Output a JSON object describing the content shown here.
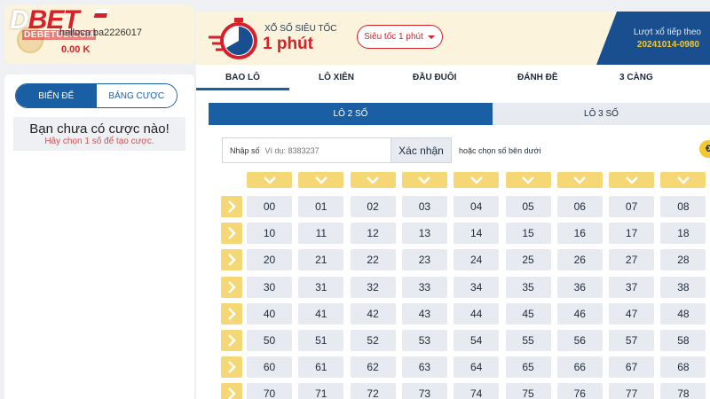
{
  "brand": {
    "logo_d": "D",
    "logo_bet": "BET",
    "logo_sub": "DEBETUS.COM"
  },
  "user": {
    "name": "helloca ba2226017",
    "balance": "0.00 K"
  },
  "left_tabs": [
    "BIẾN ĐỂ",
    "BẢNG CƯỢC"
  ],
  "empty_state": {
    "title": "Bạn chưa có cược nào!",
    "hint": "Hãy chọn 1 số để tạo cược."
  },
  "header": {
    "subtitle": "XỔ SỐ SIÊU TỐC",
    "title": "1 phút",
    "select": "Siêu tốc 1 phút",
    "next_label": "Lượt xổ tiếp theo",
    "next_value": "20241014-0980"
  },
  "bet_tabs": [
    "BAO LÔ",
    "LÔ XIÊN",
    "ĐẦU ĐUÔI",
    "ĐÁNH ĐỀ",
    "3 CÀNG"
  ],
  "sub_tabs": [
    "LÔ 2 SỐ",
    "LÔ 3 SỐ"
  ],
  "input": {
    "label": "Nhập số",
    "placeholder": "Ví dụ: 8383237",
    "confirm": "Xác nhận"
  },
  "or_text": {
    "prefix": "hoặc ",
    "emphasis": "chọn số bên dưới"
  },
  "help_glyph": "€",
  "numbers": [
    [
      "00",
      "01",
      "02",
      "03",
      "04",
      "05",
      "06",
      "07",
      "08"
    ],
    [
      "10",
      "11",
      "12",
      "13",
      "14",
      "15",
      "16",
      "17",
      "18"
    ],
    [
      "20",
      "21",
      "22",
      "23",
      "24",
      "25",
      "26",
      "27",
      "28"
    ],
    [
      "30",
      "31",
      "32",
      "33",
      "34",
      "35",
      "36",
      "37",
      "38"
    ],
    [
      "40",
      "41",
      "42",
      "43",
      "44",
      "45",
      "46",
      "47",
      "48"
    ],
    [
      "50",
      "51",
      "52",
      "53",
      "54",
      "55",
      "56",
      "57",
      "58"
    ],
    [
      "60",
      "61",
      "62",
      "63",
      "64",
      "65",
      "66",
      "67",
      "68"
    ],
    [
      "70",
      "71",
      "72",
      "73",
      "74",
      "75",
      "76",
      "77",
      "78"
    ]
  ],
  "colors": {
    "brand_red": "#d6202a",
    "primary_blue": "#1a5fa3",
    "accent_yellow": "#f5d775"
  }
}
